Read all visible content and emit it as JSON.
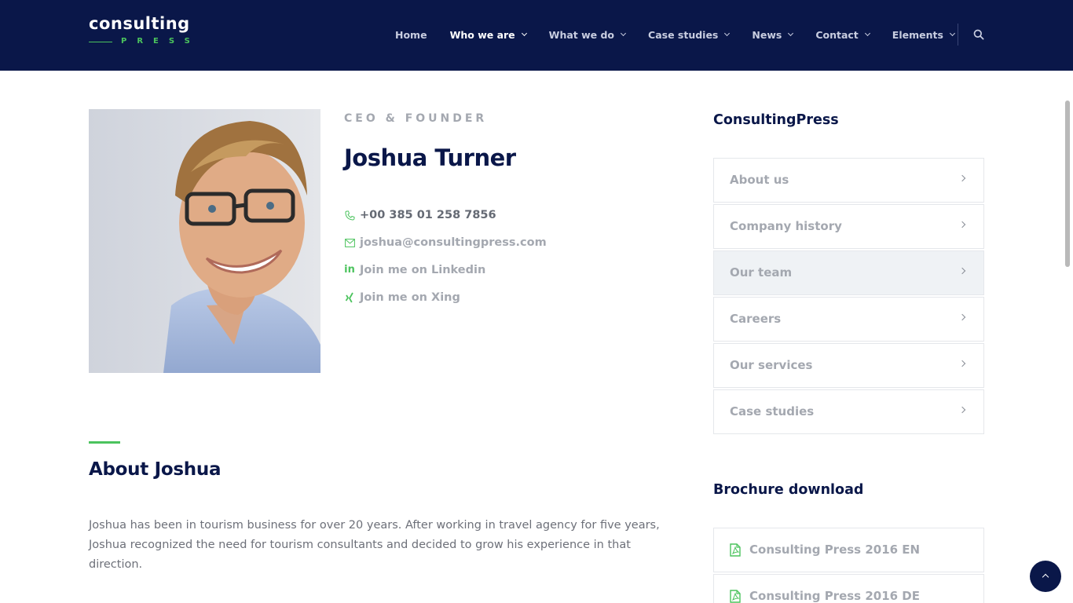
{
  "brand": {
    "name": "consulting",
    "sub": "PRESS",
    "accent": "#4bc35d",
    "navy": "#0a1749"
  },
  "nav": {
    "items": [
      {
        "label": "Home",
        "dropdown": false,
        "active": false
      },
      {
        "label": "Who we are",
        "dropdown": true,
        "active": true
      },
      {
        "label": "What we do",
        "dropdown": true,
        "active": false
      },
      {
        "label": "Case studies",
        "dropdown": true,
        "active": false
      },
      {
        "label": "News",
        "dropdown": true,
        "active": false
      },
      {
        "label": "Contact",
        "dropdown": true,
        "active": false
      },
      {
        "label": "Elements",
        "dropdown": true,
        "active": false
      }
    ],
    "search_icon": "search-icon"
  },
  "profile": {
    "role": "CEO & FOUNDER",
    "name": "Joshua Turner",
    "phone": "+00 385 01 258 7856",
    "email": "joshua@consultingpress.com",
    "linkedin": "Join me on Linkedin",
    "xing": "Join me on Xing"
  },
  "about": {
    "title": "About Joshua",
    "text": "Joshua has been in tourism business for over 20 years. After working in travel agency for five years, Joshua recognized the need for tourism consultants and decided to grow his experience in that direction."
  },
  "sidebar": {
    "title": "ConsultingPress",
    "items": [
      {
        "label": "About us",
        "active": false
      },
      {
        "label": "Company history",
        "active": false
      },
      {
        "label": "Our team",
        "active": true
      },
      {
        "label": "Careers",
        "active": false
      },
      {
        "label": "Our services",
        "active": false
      },
      {
        "label": "Case studies",
        "active": false
      }
    ],
    "brochure_title": "Brochure download",
    "brochures": [
      {
        "label": "Consulting Press 2016 EN"
      },
      {
        "label": "Consulting Press 2016 DE"
      }
    ]
  }
}
